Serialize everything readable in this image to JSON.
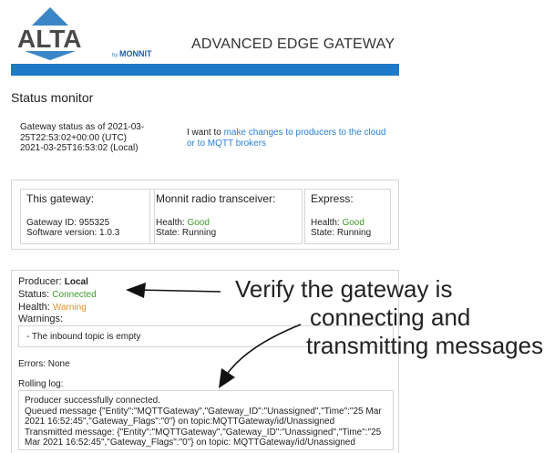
{
  "header": {
    "brand": "ALTA",
    "by_text": "by",
    "partner_brand": "MONNIT",
    "title": "ADVANCED EDGE GATEWAY"
  },
  "page": {
    "title": "Status monitor"
  },
  "status": {
    "line1": "Gateway status as of 2021-03-",
    "line2": "25T22:53:02+00:00 (UTC)",
    "line3": "2021-03-25T16:53:02 (Local)"
  },
  "link_text": {
    "prefix": "I want to ",
    "link_line1": "make changes to producers to the cloud",
    "link_line2": "or to MQTT brokers"
  },
  "cards": {
    "gateway": {
      "title": "This gateway:",
      "line1": "Gateway ID: 955325",
      "line2": "Software version: 1.0.3"
    },
    "radio": {
      "title": "Monnit radio transceiver:",
      "health_label": "Health: ",
      "health_value": "Good",
      "state": "State: Running"
    },
    "express": {
      "title": "Express:",
      "health_label": "Health: ",
      "health_value": "Good",
      "state": "State: Running"
    }
  },
  "producer": {
    "label": "Producer: ",
    "name": "Local",
    "status_label": "Status: ",
    "status_value": "Connected",
    "health_label": "Health: ",
    "health_value": "Warning",
    "warnings_label": "Warnings:",
    "warning_item": "- The inbound topic is empty",
    "errors": "Errors: None",
    "rolling_label": "Rolling log:",
    "log": [
      "Producer successfully connected.",
      "Queued message {\"Entity\":\"MQTTGateway\",\"Gateway_ID\":\"Unassigned\",\"Time\":\"25 Mar",
      "2021 16:52:45\",\"Gateway_Flags\":\"0\"} on topic:MQTTGateway/id/Unassigned",
      "Transmitted message: {\"Entity\":\"MQTTGateway\",\"Gateway_ID\":\"Unassigned\",\"Time\":\"25",
      "Mar 2021 16:52:45\",\"Gateway_Flags\":\"0\"} on topic: MQTTGateway/id/Unassigned"
    ]
  },
  "annotation": {
    "line1": "Verify the gateway is",
    "line2": "connecting and",
    "line3": "transmitting messages."
  },
  "colors": {
    "header_bar": "#1f78c8",
    "logo_blue": "#3b86c6",
    "link": "#2a7fd4",
    "good": "#3d9a2a",
    "warning": "#e0902a"
  },
  "icons": {
    "logo_mark": "triangle-logo-icon"
  }
}
